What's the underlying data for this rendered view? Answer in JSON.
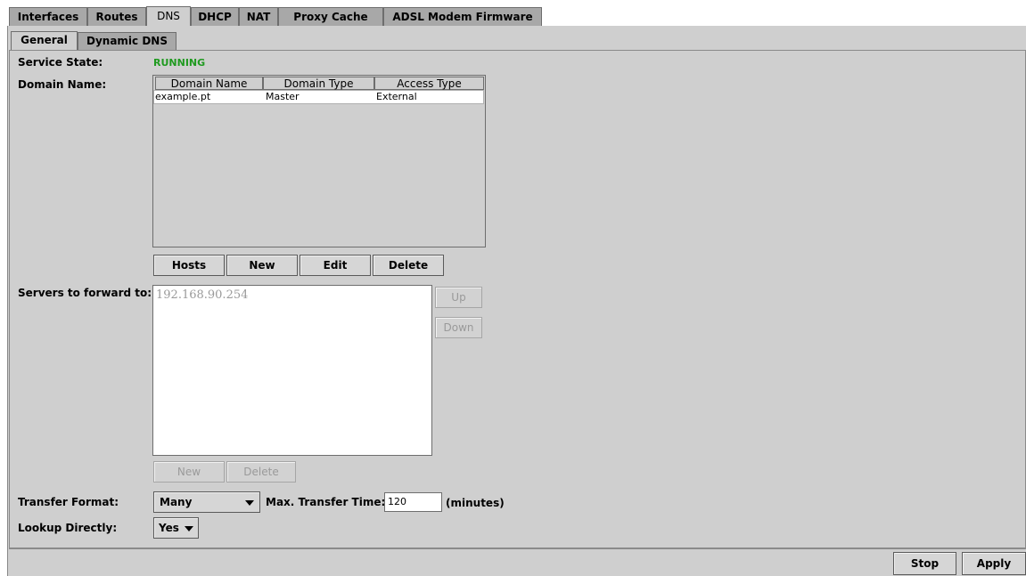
{
  "tabs": [
    "Interfaces",
    "Routes",
    "DNS",
    "DHCP",
    "NAT",
    "Proxy Cache",
    "ADSL Modem Firmware"
  ],
  "active_tab": "DNS",
  "subtabs": [
    "General",
    "Dynamic DNS"
  ],
  "active_subtab": "General",
  "service_state": {
    "label": "Service State:",
    "value": "RUNNING",
    "color": "#1f9a1f"
  },
  "domain": {
    "label": "Domain Name:",
    "columns": [
      "Domain Name",
      "Domain Type",
      "Access Type"
    ],
    "rows": [
      [
        "example.pt",
        "Master",
        "External"
      ]
    ],
    "buttons": {
      "hosts": "Hosts",
      "new": "New",
      "edit": "Edit",
      "delete": "Delete"
    }
  },
  "forward": {
    "label": "Servers to forward to:",
    "servers": [
      "192.168.90.254"
    ],
    "up": "Up",
    "down": "Down",
    "new": "New",
    "delete": "Delete"
  },
  "transfer": {
    "label": "Transfer Format:",
    "format_value": "Many",
    "max_time_label": "Max. Transfer Time:",
    "max_time_value": "120",
    "units": "(minutes)"
  },
  "lookup": {
    "label": "Lookup Directly:",
    "value": "Yes"
  },
  "footer": {
    "stop": "Stop",
    "apply": "Apply"
  }
}
